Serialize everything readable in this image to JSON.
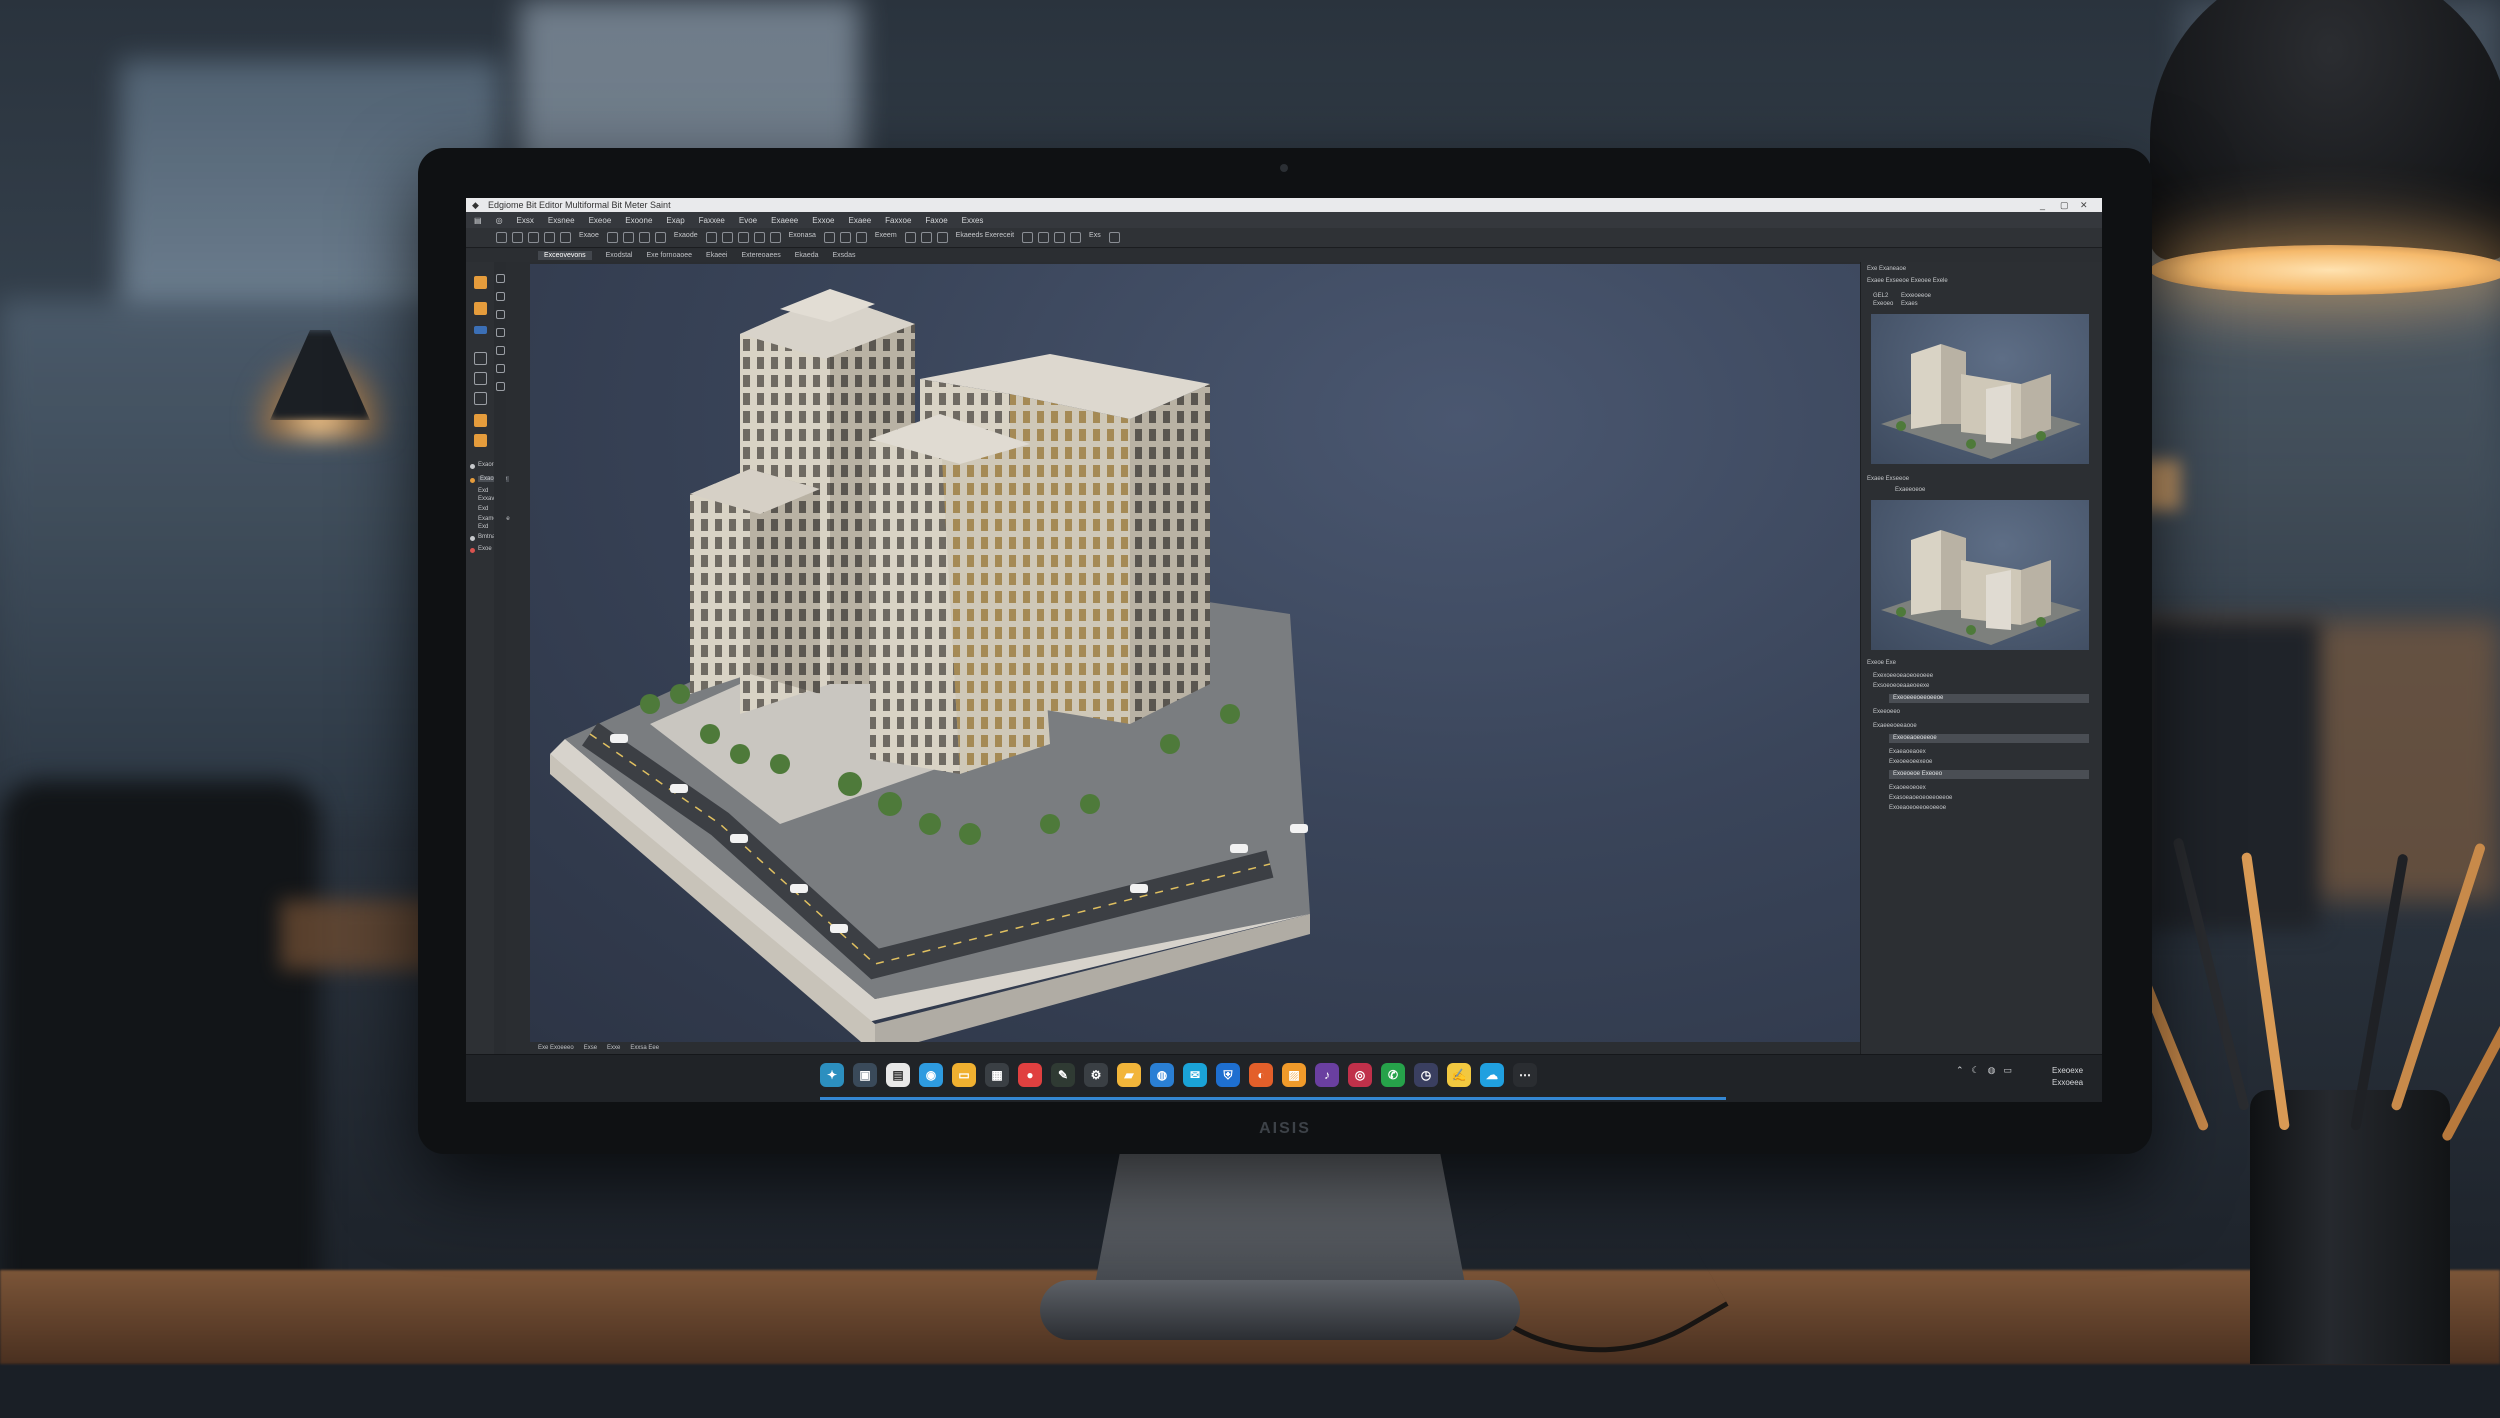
{
  "window": {
    "title": "Edgiome Bit Editor  Multiformal Bit Meter Saint",
    "controls": [
      "_",
      "▢",
      "✕"
    ]
  },
  "menu": [
    "Exsx",
    "Exsnee",
    "Exeoe",
    "Exoone",
    "Exap",
    "Faxxee",
    "Evoe",
    "Exaeee",
    "Exxoe",
    "Exaee",
    "Faxxoe",
    "Faxoe",
    "Exxes"
  ],
  "toolbar": {
    "labels": [
      "Exaoe",
      "Exaode",
      "Exonasa",
      "Exeem",
      "Ekaeeds Exereceit",
      "Exs"
    ]
  },
  "tabs": [
    "Exceovevons",
    "Exodstal",
    "Exe fornoaoee",
    "Ekaeei",
    "Extereoaees",
    "Ekaeda",
    "Exsdas"
  ],
  "left_panel": {
    "items": [
      "Exaore",
      "Exaopoee",
      "Exd",
      "Exxavoso",
      "Exd",
      "Exameasoe",
      "Exd",
      "Bmtnaoee",
      "Exoe"
    ]
  },
  "viewport": {
    "scene": "isometric city block with high-rise buildings"
  },
  "statusbar": [
    "Exe Exoeeeo",
    "Exse",
    "Exxe",
    "Exxsa Eee"
  ],
  "right_panel": {
    "header1": "Exe  Exaneaoe",
    "header2": "Exaee  Exseeoe  Exeoee  Exele",
    "lbl_a": "GEL2",
    "lbl_b": "Exxeoeeoe",
    "lbl_c": "Exeoeo",
    "lbl_d": "Exaes",
    "section2": "Exaee   Exseeoe",
    "lbl_e": "Exaeeoeoe",
    "section3": "Exeoe  Exe",
    "props": [
      "Exexoeeoeaoeoeoeee",
      "Exsoeoeoeaaeoeexe",
      "Exeeoeeo",
      "Exaeeeoeeaooe",
      "Exaeaoeaoex",
      "Exeoeeoeexeoe",
      "Exaoeeoeoex",
      "Exasoeaoeoeoeeoeeoe",
      "Exoeaoeoeeoeoeeoe"
    ],
    "fields": [
      "Exeoeeeoeeoeeoe",
      "Exeoeaoeoeeoe",
      "Exoeoeoe Exeoeo"
    ]
  },
  "taskbar": {
    "tray": [
      "⌃",
      "☾",
      "◍",
      "▭"
    ],
    "clock_time": "Exeoexe",
    "clock_date": "Exxoeea"
  },
  "monitor_brand": "AISIS",
  "colors": {
    "accent": "#3aa0ff",
    "screen_bg": "#2a2d31",
    "viewport_bg": "#3a455a"
  }
}
